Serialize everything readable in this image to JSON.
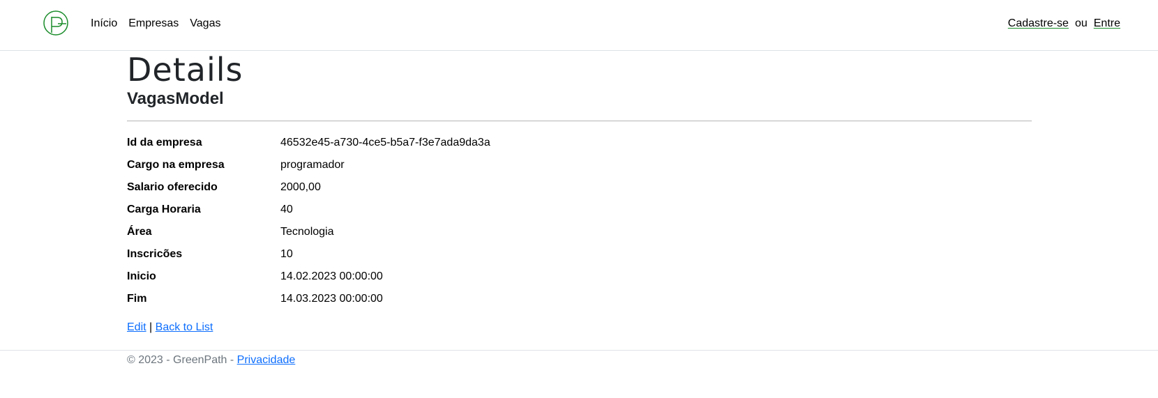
{
  "brand": {
    "logo_icon": "greenpath-logo-icon",
    "accent_color": "#1a8c2a"
  },
  "nav": {
    "items": [
      {
        "label": "Início"
      },
      {
        "label": "Empresas"
      },
      {
        "label": "Vagas"
      }
    ],
    "signup_label": "Cadastre-se",
    "or_label": "ou",
    "login_label": "Entre"
  },
  "page": {
    "title": "Details",
    "subtitle": "VagasModel"
  },
  "details": [
    {
      "label": "Id da empresa",
      "value": "46532e45-a730-4ce5-b5a7-f3e7ada9da3a"
    },
    {
      "label": "Cargo na empresa",
      "value": "programador"
    },
    {
      "label": "Salario oferecido",
      "value": "2000,00"
    },
    {
      "label": "Carga Horaria",
      "value": "40"
    },
    {
      "label": "Área",
      "value": "Tecnologia"
    },
    {
      "label": "Inscricões",
      "value": "10"
    },
    {
      "label": "Inicio",
      "value": "14.02.2023 00:00:00"
    },
    {
      "label": "Fim",
      "value": "14.03.2023 00:00:00"
    }
  ],
  "actions": {
    "edit_label": "Edit",
    "separator": "|",
    "back_label": "Back to List"
  },
  "footer": {
    "text": "© 2023 - GreenPath - ",
    "privacy_label": "Privacidade"
  }
}
